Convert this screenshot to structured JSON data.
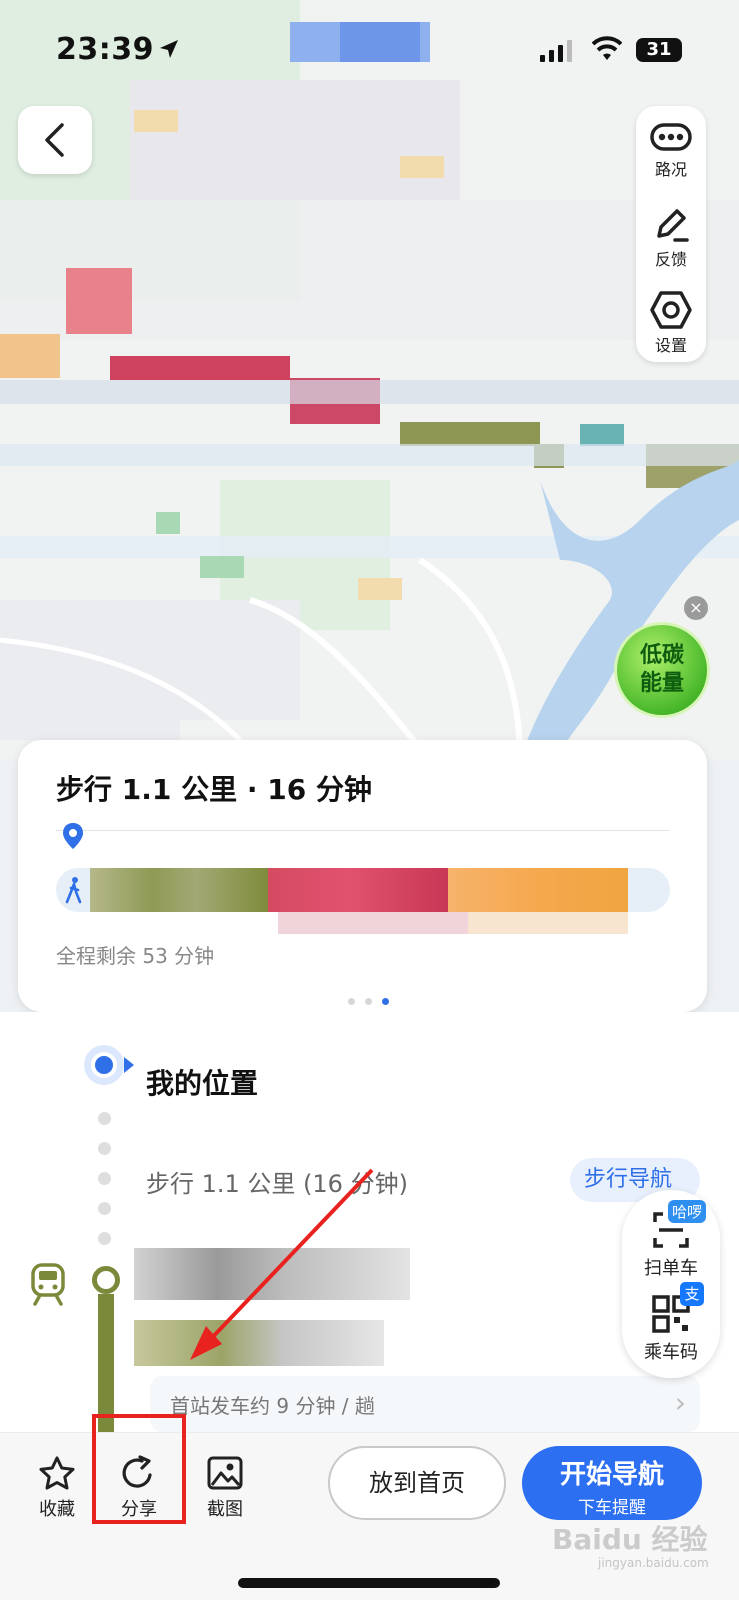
{
  "status_bar": {
    "time": "23:39",
    "battery": "31"
  },
  "map_tools": {
    "traffic_label": "路况",
    "feedback_label": "反馈",
    "settings_label": "设置"
  },
  "eco_badge": {
    "text_line1": "低碳",
    "text_line2": "能量",
    "close": "×"
  },
  "route_card": {
    "title": "步行  1.1 公里 · 16 分钟",
    "remaining": "全程剩余 53 分钟",
    "page_count": 3,
    "active_page": 3
  },
  "details": {
    "my_location": "我的位置",
    "walk_step": "步行 1.1 公里 (16 分钟)",
    "walk_nav_button": "步行导航",
    "first_train_info": "首站发车约 9 分钟 / 趟"
  },
  "quick_actions": {
    "scan_bike_label": "扫单车",
    "scan_bike_tag": "哈啰",
    "ride_code_label": "乘车码",
    "ride_code_tag": "支"
  },
  "bottom_bar": {
    "favorite_label": "收藏",
    "share_label": "分享",
    "screenshot_label": "截图",
    "home_button": "放到首页",
    "nav_button_main": "开始导航",
    "nav_button_sub": "下车提醒"
  },
  "colors": {
    "accent_blue": "#2c6ff1",
    "metro_line": "#7a8a3a",
    "highlight_red": "#e8231f"
  },
  "watermark": {
    "text": "Baidu 经验",
    "sub": "jingyan.baidu.com"
  }
}
